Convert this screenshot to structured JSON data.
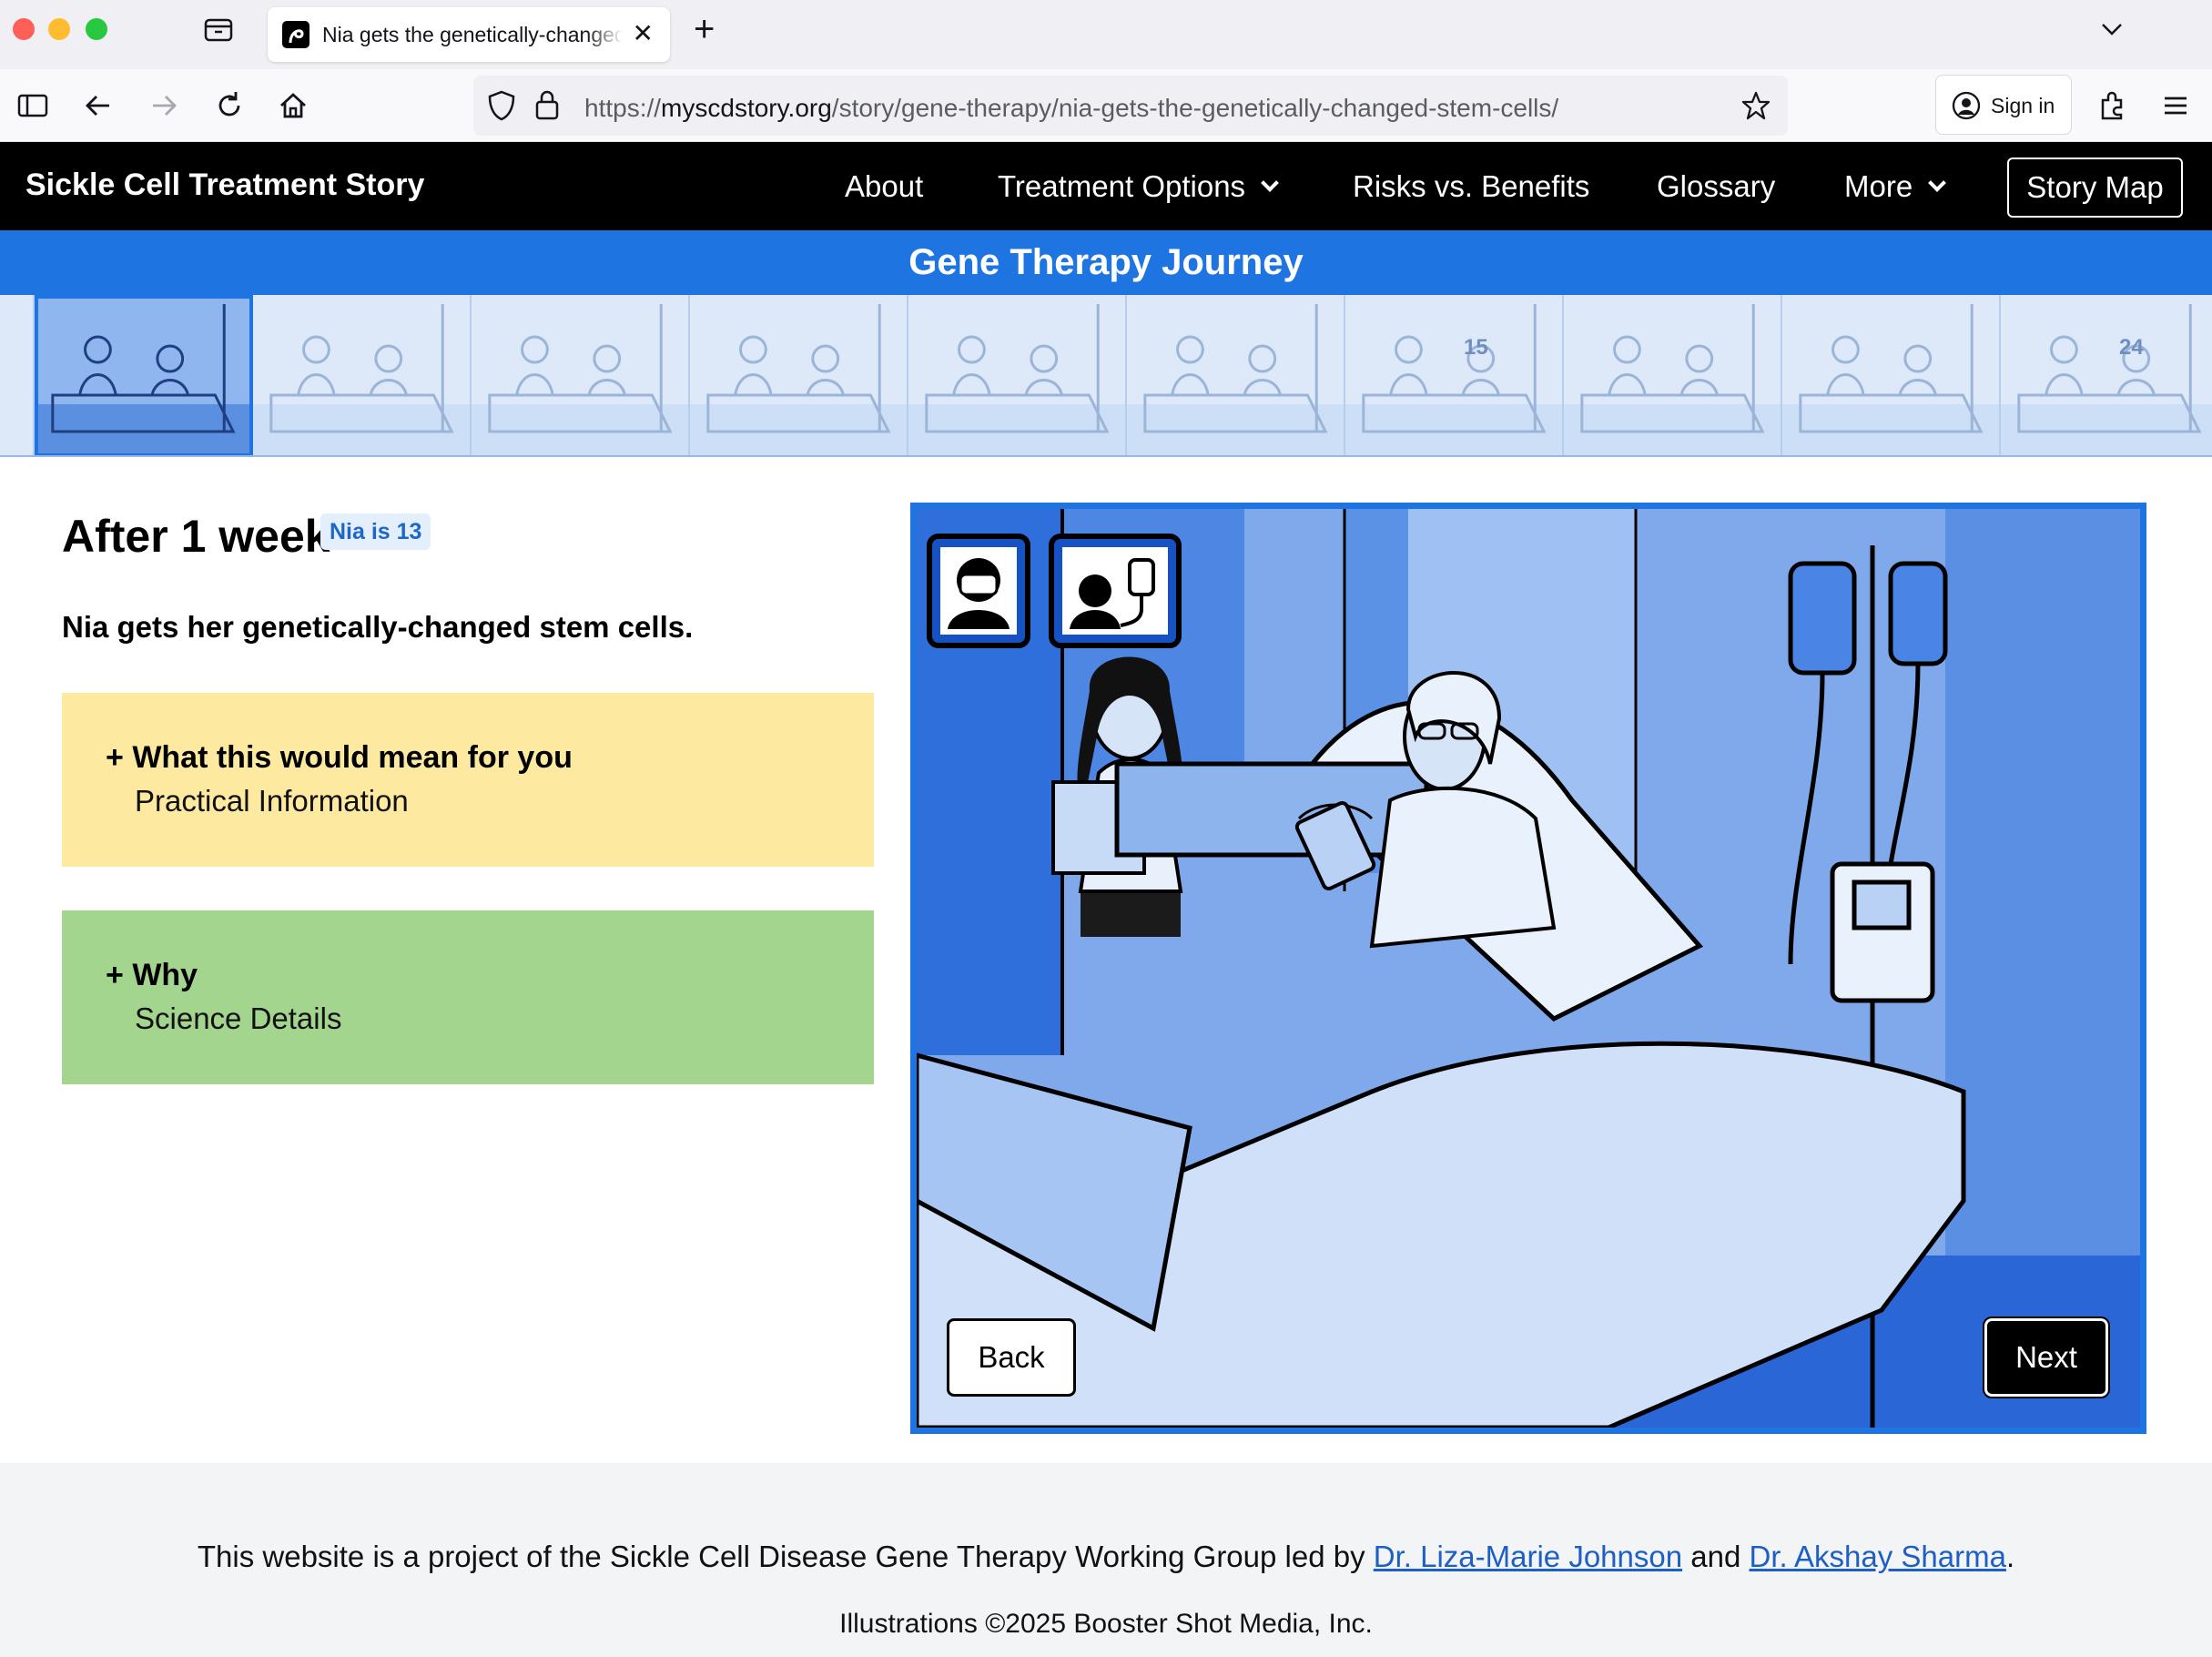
{
  "browser": {
    "tab_title": "Nia gets the genetically-changed stem cells",
    "url_scheme": "https://",
    "url_host": "myscdstory.org",
    "url_path": "/story/gene-therapy/nia-gets-the-genetically-changed-stem-cells/",
    "sign_in_label": "Sign in"
  },
  "site": {
    "title": "Sickle Cell Treatment Story",
    "menu": {
      "about": "About",
      "treatment_options": "Treatment Options",
      "risks_benefits": "Risks vs. Benefits",
      "glossary": "Glossary",
      "more": "More",
      "story_map": "Story Map"
    },
    "section_title": "Gene Therapy Journey"
  },
  "filmstrip": {
    "frame_count": 11,
    "active_index": 0,
    "frame_labels": [
      "",
      "",
      "",
      "",
      "",
      "",
      "15",
      "",
      "",
      "24",
      ""
    ]
  },
  "content": {
    "heading": "After 1 week",
    "age_badge": "Nia is 13",
    "summary": "Nia gets her genetically-changed stem cells.",
    "accordions": [
      {
        "title": "What this would mean for you",
        "subtitle": "Practical Information",
        "expanded": false
      },
      {
        "title": "Why",
        "subtitle": "Science Details",
        "expanded": false
      }
    ],
    "back_label": "Back",
    "next_label": "Next"
  },
  "footer": {
    "line1_prefix": "This website is a project of the Sickle Cell Disease Gene Therapy Working Group led by ",
    "link1": "Dr. Liza-Marie Johnson",
    "and": " and ",
    "link2": "Dr. Akshay Sharma",
    "period": ".",
    "line2": "Illustrations ©2025 Booster Shot Media, Inc."
  },
  "colors": {
    "accent_blue": "#1e74e0",
    "yellow_panel": "#fde9a0",
    "green_panel": "#a3d58f",
    "header_black": "#000000"
  },
  "icons": {
    "panel_icon_1": "masked-person-icon",
    "panel_icon_2": "person-iv-infusion-icon"
  }
}
